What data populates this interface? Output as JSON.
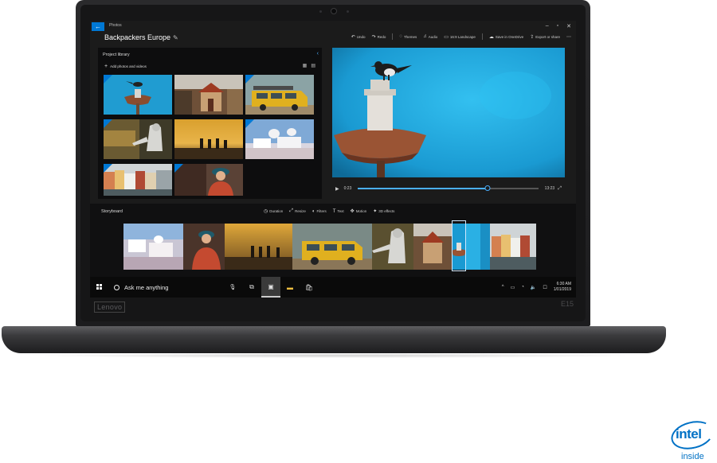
{
  "window": {
    "app_name": "Photos",
    "project_title": "Backpackers Europe",
    "controls": [
      "–",
      "▫",
      "✕"
    ],
    "toolbar": [
      {
        "label": "Undo",
        "icon": "undo-icon",
        "glyph": "↶"
      },
      {
        "label": "Redo",
        "icon": "redo-icon",
        "glyph": "↷"
      },
      {
        "label": "Themes",
        "icon": "themes-icon",
        "glyph": "◌"
      },
      {
        "label": "Audio",
        "icon": "audio-icon",
        "glyph": "♫"
      },
      {
        "label": "16:9 Landscape",
        "icon": "aspect-icon",
        "glyph": "▭"
      },
      {
        "label": "Save in OneDrive",
        "icon": "cloud-icon",
        "glyph": "☁"
      },
      {
        "label": "Export or share",
        "icon": "share-icon",
        "glyph": "⇪"
      }
    ]
  },
  "library": {
    "title": "Project library",
    "add_label": "Add photos and videos"
  },
  "player": {
    "current_time": "0:23",
    "total_time": "13:23",
    "progress": 0.72
  },
  "storyboard": {
    "title": "Storyboard",
    "tools": [
      {
        "label": "Duration",
        "icon": "clock-icon",
        "glyph": "◷"
      },
      {
        "label": "Resize",
        "icon": "resize-icon",
        "glyph": "⤢"
      },
      {
        "label": "Filters",
        "icon": "filters-icon",
        "glyph": "◐"
      },
      {
        "label": "Text",
        "icon": "text-icon",
        "glyph": "T"
      },
      {
        "label": "Motion",
        "icon": "motion-icon",
        "glyph": "✥"
      },
      {
        "label": "3D effects",
        "icon": "3d-effects-icon",
        "glyph": "✦"
      }
    ]
  },
  "taskbar": {
    "search_text": "Ask me anything",
    "time": "6:30 AM",
    "date": "1/01/2019"
  },
  "laptop": {
    "brand": "Lenovo",
    "model": "E15"
  },
  "badge": {
    "word": "intel",
    "inside": "inside"
  },
  "colors": {
    "accent": "#0078d4",
    "intel_blue": "#0071c5",
    "sky": "#1ea0d8"
  }
}
